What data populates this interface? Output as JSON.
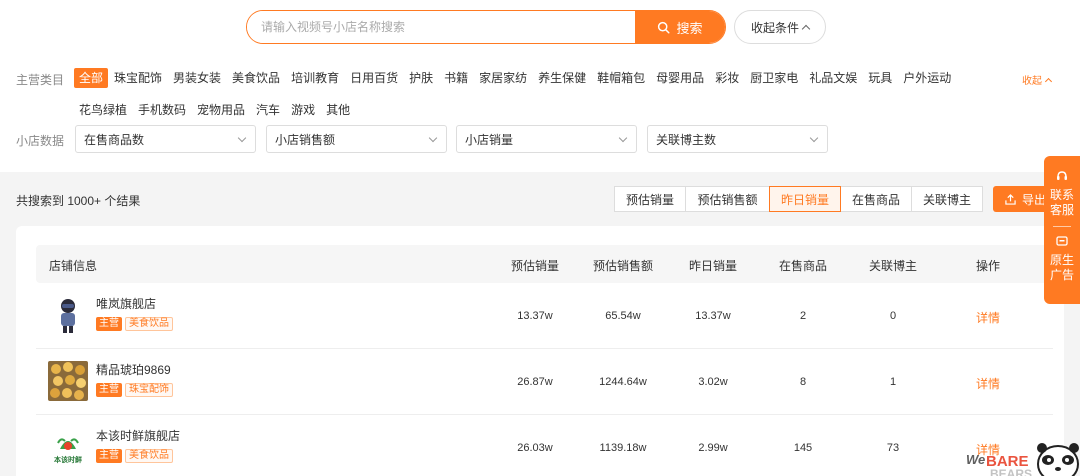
{
  "search": {
    "placeholder": "请输入视频号小店名称搜索",
    "button_label": "搜索",
    "collapse_label": "收起条件"
  },
  "categories": {
    "label": "主营类目",
    "collapse_label": "收起",
    "items": [
      "全部",
      "珠宝配饰",
      "男装女装",
      "美食饮品",
      "培训教育",
      "日用百货",
      "护肤",
      "书籍",
      "家居家纺",
      "养生保健",
      "鞋帽箱包",
      "母婴用品",
      "彩妆",
      "厨卫家电",
      "礼品文娱",
      "玩具",
      "户外运动",
      "花鸟绿植",
      "手机数码",
      "宠物用品",
      "汽车",
      "游戏",
      "其他"
    ],
    "active_index": 0
  },
  "store_data": {
    "label": "小店数据",
    "filters": [
      "在售商品数",
      "小店销售额",
      "小店销量",
      "关联博主数"
    ]
  },
  "results": {
    "count_text": "共搜索到 1000+ 个结果",
    "sort_buttons": [
      "预估销量",
      "预估销售额",
      "昨日销量",
      "在售商品",
      "关联博主"
    ],
    "active_sort": 2,
    "export_label": "导出"
  },
  "table": {
    "headers": [
      "店铺信息",
      "预估销量",
      "预估销售额",
      "昨日销量",
      "在售商品",
      "关联博主",
      "操作"
    ],
    "main_tag": "主营",
    "detail_label": "详情",
    "rows": [
      {
        "name": "唯岚旗舰店",
        "category": "美食饮品",
        "est_sales": "13.37w",
        "est_revenue": "65.54w",
        "yesterday_sales": "13.37w",
        "products": "2",
        "bloggers": "0",
        "action": "详情"
      },
      {
        "name": "精品琥珀9869",
        "category": "珠宝配饰",
        "est_sales": "26.87w",
        "est_revenue": "1244.64w",
        "yesterday_sales": "3.02w",
        "products": "8",
        "bloggers": "1",
        "action": "详情"
      },
      {
        "name": "本该时鲜旗舰店",
        "category": "美食饮品",
        "est_sales": "26.03w",
        "est_revenue": "1139.18w",
        "yesterday_sales": "2.99w",
        "products": "145",
        "bloggers": "73",
        "action": "详情",
        "logo_text": "本该时鲜"
      }
    ]
  },
  "side": {
    "contact": "联系客服",
    "ad": "原生广告"
  },
  "watermark_text": "BARE BEARS",
  "colors": {
    "accent": "#ff7a22",
    "gray_bg": "#f4f4f4"
  }
}
